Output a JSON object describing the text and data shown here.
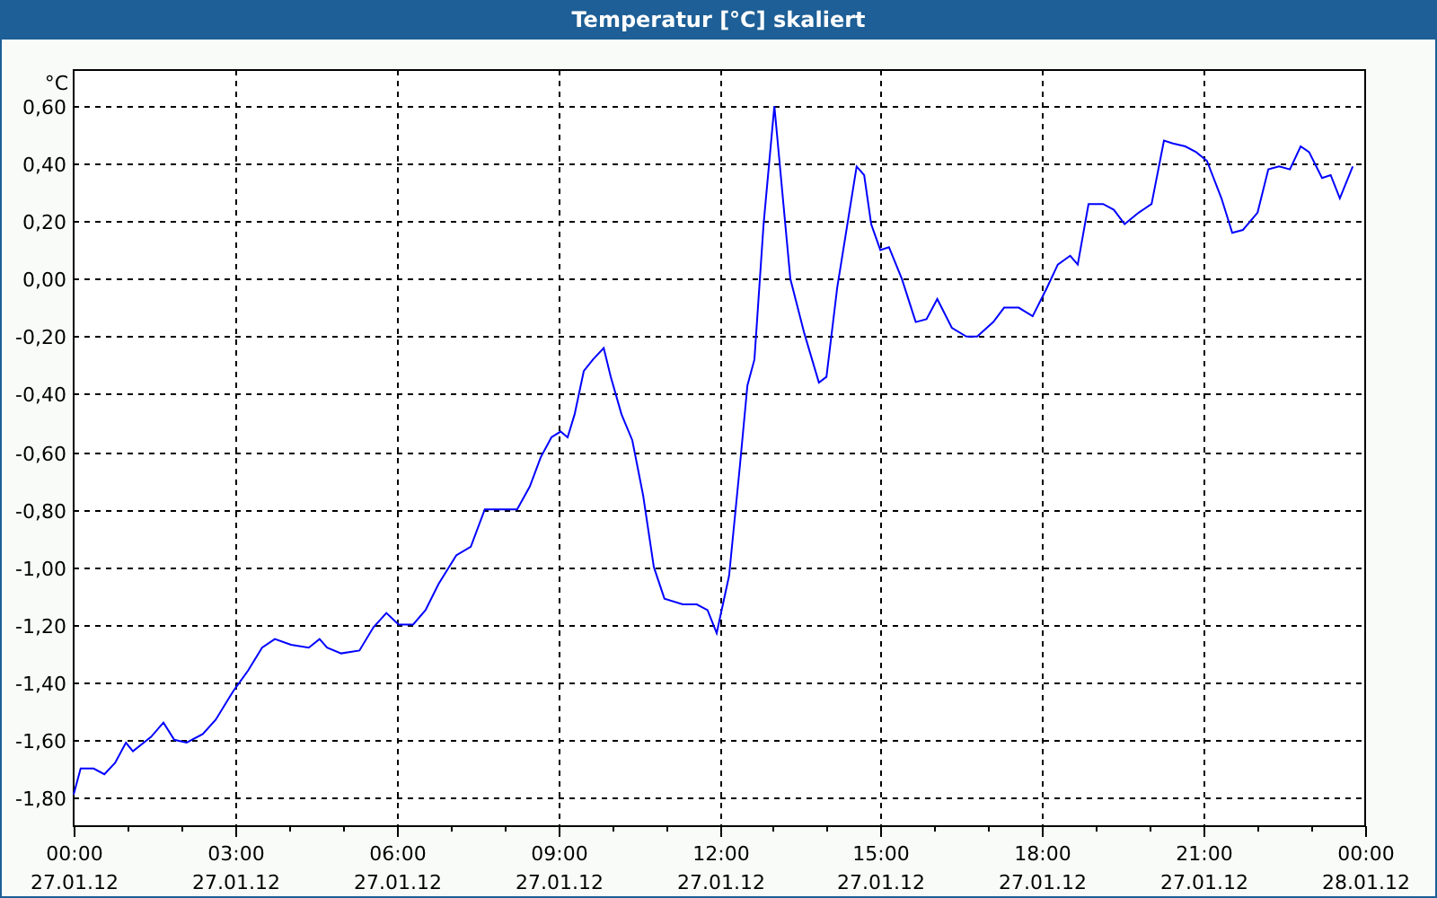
{
  "window": {
    "title": "Temperatur [°C] skaliert"
  },
  "chart": {
    "chart_data": {
      "type": "line",
      "grid": true,
      "ylabel": "°C",
      "xlim": [
        0,
        24
      ],
      "ylim": [
        -1.9,
        0.725
      ],
      "xticks": [
        {
          "value": 0,
          "label": "00:00"
        },
        {
          "value": 3,
          "label": "03:00"
        },
        {
          "value": 6,
          "label": "06:00"
        },
        {
          "value": 9,
          "label": "09:00"
        },
        {
          "value": 12,
          "label": "12:00"
        },
        {
          "value": 15,
          "label": "15:00"
        },
        {
          "value": 18,
          "label": "18:00"
        },
        {
          "value": 21,
          "label": "21:00"
        },
        {
          "value": 24,
          "label": "00:00"
        }
      ],
      "annotations": [
        "27.01.12",
        "27.01.12",
        "27.01.12",
        "27.01.12",
        "27.01.12",
        "27.01.12",
        "27.01.12",
        "27.01.12",
        "28.01.12"
      ],
      "yticks": [
        {
          "value": 0.6,
          "label": "0,60"
        },
        {
          "value": 0.4,
          "label": "0,40"
        },
        {
          "value": 0.2,
          "label": "0,20"
        },
        {
          "value": 0,
          "label": "0,00"
        },
        {
          "value": -0.2,
          "label": "-0,20"
        },
        {
          "value": -0.4,
          "label": "-0,40"
        },
        {
          "value": -0.6,
          "label": "-0,60"
        },
        {
          "value": -0.8,
          "label": "-0,80"
        },
        {
          "value": -1.0,
          "label": "-1,00"
        },
        {
          "value": -1.2,
          "label": "-1,20"
        },
        {
          "value": -1.4,
          "label": "-1,40"
        },
        {
          "value": -1.6,
          "label": "-1,60"
        },
        {
          "value": -1.8,
          "label": "-1,80"
        }
      ],
      "x": [
        0,
        0.13,
        0.37,
        0.57,
        0.77,
        0.97,
        1.1,
        1.44,
        1.67,
        1.87,
        2.1,
        2.4,
        2.64,
        2.97,
        3.24,
        3.5,
        3.74,
        4.04,
        4.37,
        4.57,
        4.71,
        4.97,
        5.31,
        5.57,
        5.81,
        6.04,
        6.31,
        6.54,
        6.78,
        7.11,
        7.38,
        7.64,
        7.91,
        8.24,
        8.48,
        8.68,
        8.88,
        9.05,
        9.18,
        9.31,
        9.48,
        9.65,
        9.85,
        9.98,
        10.18,
        10.38,
        10.58,
        10.78,
        10.98,
        11.32,
        11.58,
        11.78,
        11.95,
        12.18,
        12.38,
        12.52,
        12.65,
        12.82,
        13.02,
        13.32,
        13.58,
        13.85,
        13.99,
        14.19,
        14.55,
        14.69,
        14.82,
        14.99,
        15.15,
        15.39,
        15.65,
        15.85,
        16.05,
        16.32,
        16.59,
        16.79,
        17.09,
        17.29,
        17.56,
        17.82,
        18.09,
        18.29,
        18.52,
        18.66,
        18.86,
        19.13,
        19.33,
        19.53,
        19.79,
        20.03,
        20.26,
        20.43,
        20.66,
        20.86,
        21.06,
        21.33,
        21.53,
        21.73,
        22.0,
        22.2,
        22.4,
        22.6,
        22.8,
        22.96,
        23.2,
        23.36,
        23.53,
        23.77
      ],
      "series": [
        {
          "color": "#0000ff",
          "values": [
            -1.79,
            -1.7,
            -1.7,
            -1.72,
            -1.68,
            -1.61,
            -1.64,
            -1.59,
            -1.54,
            -1.6,
            -1.61,
            -1.58,
            -1.53,
            -1.43,
            -1.36,
            -1.28,
            -1.25,
            -1.27,
            -1.28,
            -1.25,
            -1.28,
            -1.3,
            -1.29,
            -1.21,
            -1.16,
            -1.2,
            -1.2,
            -1.15,
            -1.06,
            -0.96,
            -0.93,
            -0.8,
            -0.8,
            -0.8,
            -0.72,
            -0.62,
            -0.55,
            -0.53,
            -0.55,
            -0.47,
            -0.32,
            -0.28,
            -0.24,
            -0.34,
            -0.47,
            -0.56,
            -0.75,
            -1.0,
            -1.11,
            -1.13,
            -1.13,
            -1.15,
            -1.23,
            -1.03,
            -0.65,
            -0.37,
            -0.28,
            0.19,
            0.6,
            0.0,
            -0.19,
            -0.36,
            -0.34,
            -0.03,
            0.39,
            0.36,
            0.19,
            0.1,
            0.11,
            0.0,
            -0.15,
            -0.14,
            -0.07,
            -0.17,
            -0.2,
            -0.2,
            -0.15,
            -0.1,
            -0.1,
            -0.13,
            -0.03,
            0.05,
            0.08,
            0.05,
            0.26,
            0.26,
            0.24,
            0.19,
            0.23,
            0.26,
            0.48,
            0.47,
            0.46,
            0.44,
            0.41,
            0.28,
            0.16,
            0.17,
            0.23,
            0.38,
            0.39,
            0.38,
            0.46,
            0.44,
            0.35,
            0.36,
            0.28,
            0.39
          ]
        }
      ]
    }
  }
}
